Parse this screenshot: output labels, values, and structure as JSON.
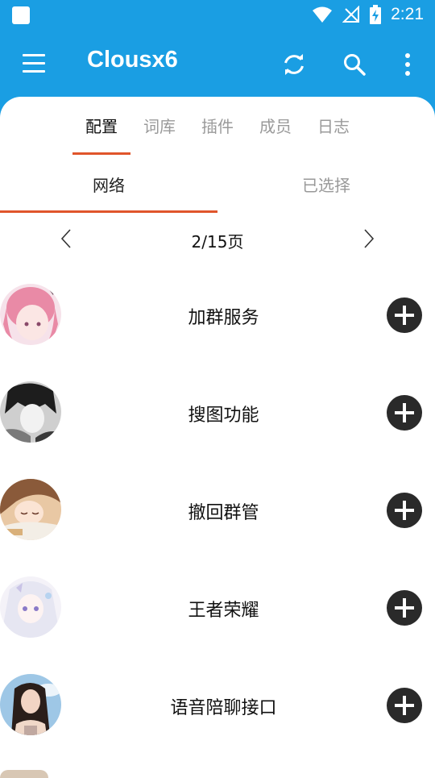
{
  "status_bar": {
    "time": "2:21"
  },
  "app_bar": {
    "title": "Clousx6"
  },
  "tabs": [
    {
      "label": "配置",
      "active": true
    },
    {
      "label": "词库",
      "active": false
    },
    {
      "label": "插件",
      "active": false
    },
    {
      "label": "成员",
      "active": false
    },
    {
      "label": "日志",
      "active": false
    }
  ],
  "sub_tabs": [
    {
      "label": "网络",
      "active": true
    },
    {
      "label": "已选择",
      "active": false
    }
  ],
  "pager": {
    "text": "2/15页"
  },
  "items": [
    {
      "name": "加群服务",
      "avatar": "pink-hair-anime-avatar"
    },
    {
      "name": "搜图功能",
      "avatar": "monochrome-anime-avatar"
    },
    {
      "name": "撤回群管",
      "avatar": "sleeping-girl-avatar"
    },
    {
      "name": "王者荣耀",
      "avatar": "white-hair-anime-avatar"
    },
    {
      "name": "语音陪聊接口",
      "avatar": "portrait-girl-avatar"
    }
  ],
  "colors": {
    "app_bar": "#1a9ee3",
    "indicator": "#e0552b",
    "add_button": "#2a2a2a"
  }
}
